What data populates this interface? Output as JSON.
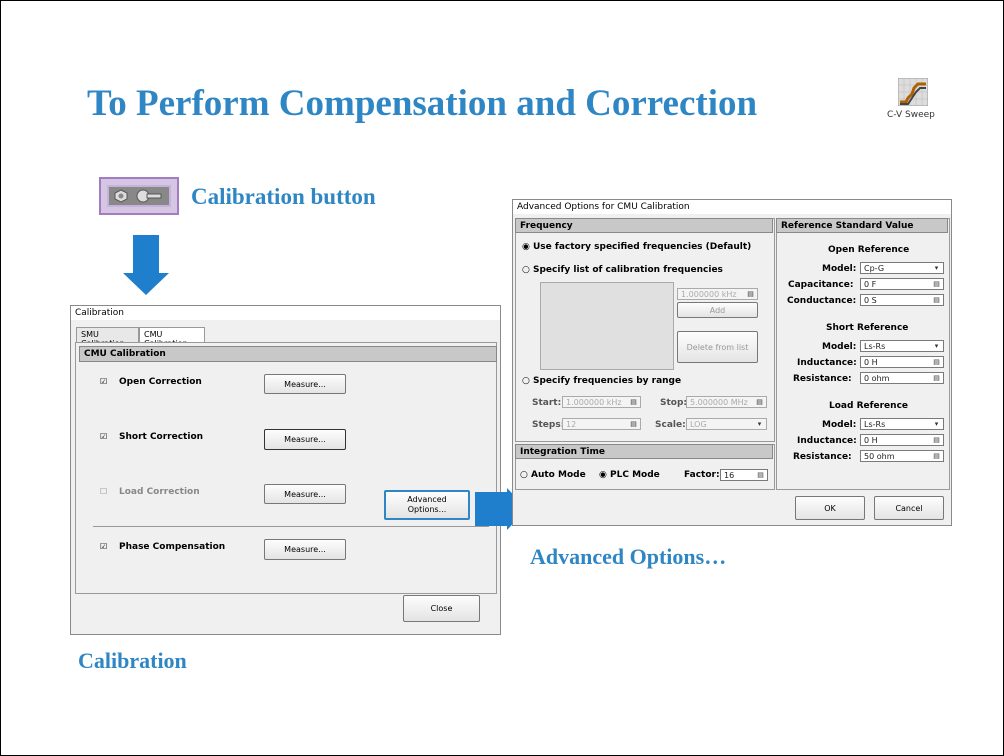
{
  "slide": {
    "title": "To Perform Compensation and Correction",
    "cv_sweep_label": "C-V Sweep",
    "calibration_button_caption": "Calibration button",
    "calibration_caption": "Calibration",
    "advanced_caption": "Advanced Options…"
  },
  "calibration_window": {
    "title": "Calibration",
    "tabs": [
      "SMU Calibration",
      "CMU Calibration"
    ],
    "active_tab": "CMU Calibration",
    "section": "CMU Calibration",
    "rows": [
      {
        "label": "Open Correction",
        "checked": true,
        "enabled": true,
        "button": "Measure..."
      },
      {
        "label": "Short Correction",
        "checked": true,
        "enabled": true,
        "button": "Measure..."
      },
      {
        "label": "Load Correction",
        "checked": false,
        "enabled": false,
        "button": "Measure..."
      },
      {
        "label": "Phase Compensation",
        "checked": true,
        "enabled": true,
        "button": "Measure..."
      }
    ],
    "advanced_button": "Advanced\nOptions...",
    "close_button": "Close"
  },
  "advanced_window": {
    "title": "Advanced Options for CMU Calibration",
    "frequency": {
      "header": "Frequency",
      "option_default": "Use factory specified frequencies (Default)",
      "option_list": "Specify list of calibration frequencies",
      "list_value": "1.000000 kHz",
      "add_button": "Add",
      "delete_button": "Delete from list",
      "option_range": "Specify frequencies by range",
      "start_label": "Start:",
      "start_value": "1.000000 kHz",
      "stop_label": "Stop:",
      "stop_value": "5.000000 MHz",
      "steps_label": "Steps:",
      "steps_value": "12",
      "scale_label": "Scale:",
      "scale_value": "LOG"
    },
    "integration": {
      "header": "Integration Time",
      "auto_mode": "Auto Mode",
      "plc_mode": "PLC Mode",
      "factor_label": "Factor:",
      "factor_value": "16"
    },
    "reference": {
      "header": "Reference Standard Value",
      "open": {
        "title": "Open Reference",
        "model_label": "Model:",
        "model_value": "Cp-G",
        "p1_label": "Capacitance:",
        "p1_value": "0 F",
        "p2_label": "Conductance:",
        "p2_value": "0 S"
      },
      "short": {
        "title": "Short Reference",
        "model_label": "Model:",
        "model_value": "Ls-Rs",
        "p1_label": "Inductance:",
        "p1_value": "0 H",
        "p2_label": "Resistance:",
        "p2_value": "0 ohm"
      },
      "load": {
        "title": "Load Reference",
        "model_label": "Model:",
        "model_value": "Ls-Rs",
        "p1_label": "Inductance:",
        "p1_value": "0 H",
        "p2_label": "Resistance:",
        "p2_value": "50 ohm"
      }
    },
    "ok_button": "OK",
    "cancel_button": "Cancel"
  },
  "colors": {
    "accent_blue": "#2f86c4",
    "arrow_blue": "#1f7fcc"
  }
}
